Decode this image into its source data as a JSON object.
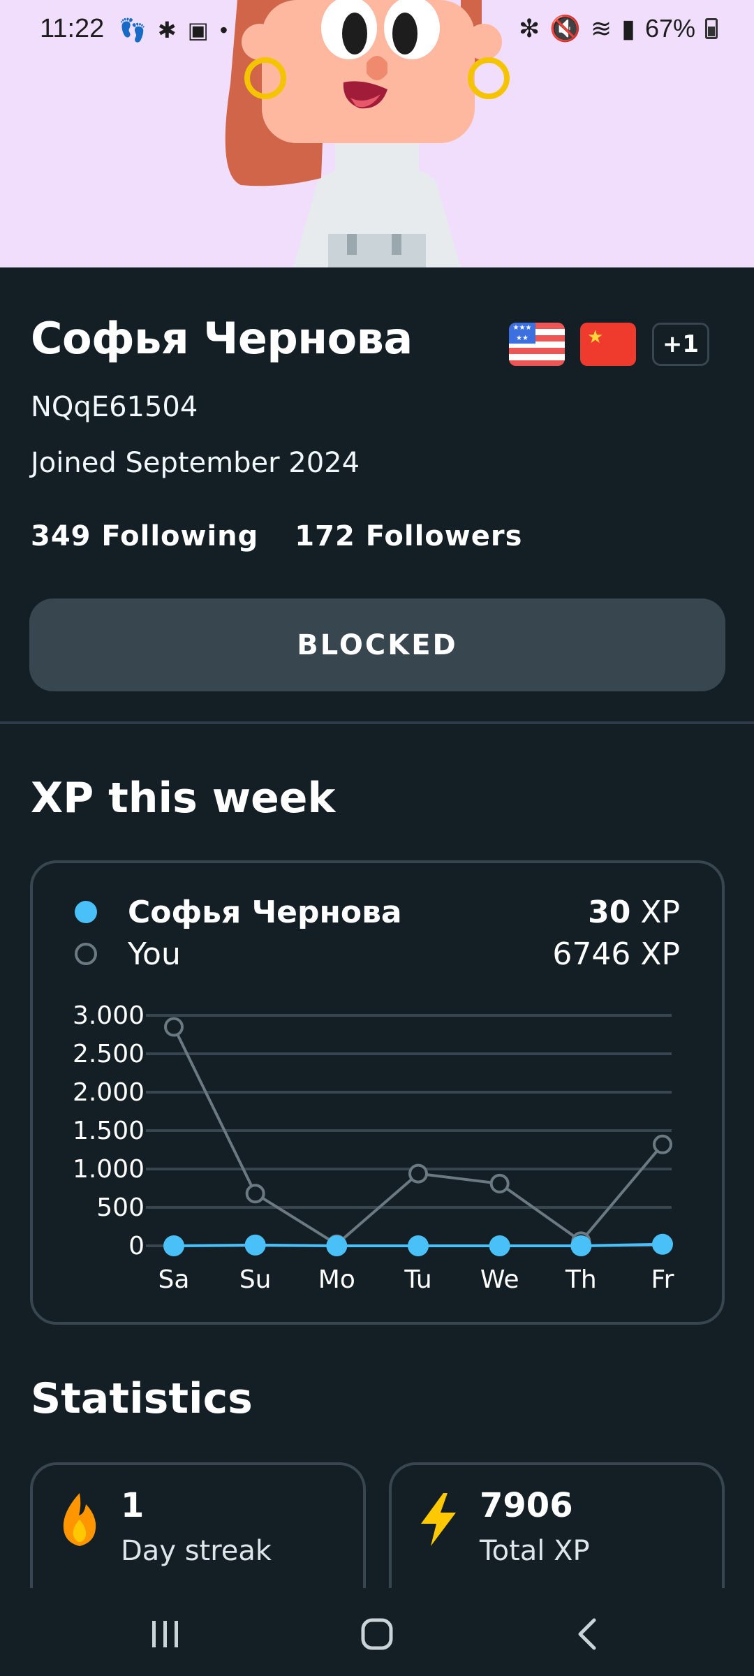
{
  "status_bar": {
    "time": "11:22",
    "battery": "67%"
  },
  "profile": {
    "name": "Софья Чернова",
    "username": "NQqE61504",
    "joined": "Joined September 2024",
    "following": "349 Following",
    "followers": "172 Followers",
    "languages": [
      "us-flag-icon",
      "cn-flag-icon"
    ],
    "more_languages": "+1",
    "blocked_button": "BLOCKED"
  },
  "xp_section": {
    "title": "XP this week",
    "legend": [
      {
        "name": "Софья Чернова",
        "xp_value": "30",
        "xp_unit": "XP",
        "color": "#49C0F8"
      },
      {
        "name": "You",
        "xp_text": "6746 XP",
        "color": "#6b7a82"
      }
    ]
  },
  "chart_data": {
    "type": "line",
    "categories": [
      "Sa",
      "Su",
      "Mo",
      "Tu",
      "We",
      "Th",
      "Fr"
    ],
    "y_ticks": [
      "3.000",
      "2.500",
      "2.000",
      "1.500",
      "1.000",
      "500",
      "0"
    ],
    "ylim": [
      0,
      3000
    ],
    "grid": true,
    "series": [
      {
        "name": "You",
        "values": [
          2850,
          680,
          20,
          940,
          810,
          60,
          1320
        ],
        "color": "#6b7a82",
        "marker": "hollow"
      },
      {
        "name": "Софья Чернова",
        "values": [
          0,
          10,
          0,
          0,
          0,
          0,
          20
        ],
        "color": "#49C0F8",
        "marker": "filled"
      }
    ]
  },
  "stats_section": {
    "title": "Statistics",
    "cards": [
      {
        "value": "1",
        "label": "Day streak",
        "icon": "flame-icon"
      },
      {
        "value": "7906",
        "label": "Total XP",
        "icon": "lightning-icon"
      }
    ]
  },
  "colors": {
    "background": "#131F24",
    "card_border": "#37464F",
    "accent_blue": "#49C0F8",
    "hero_bg": "#F0DEFC"
  }
}
